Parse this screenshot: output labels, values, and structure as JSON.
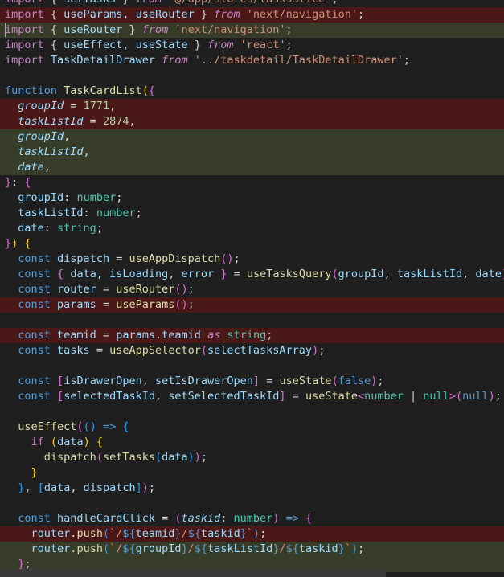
{
  "editor": {
    "lines": [
      [
        {
          "t": "import",
          "c": "k"
        },
        {
          "t": " { ",
          "c": "p"
        },
        {
          "t": "setTasks",
          "c": "v"
        },
        {
          "t": " } ",
          "c": "p"
        },
        {
          "t": "from",
          "c": "k i"
        },
        {
          "t": " ",
          "c": "p"
        },
        {
          "t": "'@/app/stores/tasksSlice'",
          "c": "s"
        },
        {
          "t": ";",
          "c": "p"
        }
      ],
      [
        {
          "t": "import",
          "c": "k"
        },
        {
          "t": " { ",
          "c": "p"
        },
        {
          "t": "useParams",
          "c": "v"
        },
        {
          "t": ", ",
          "c": "p"
        },
        {
          "t": "useRouter",
          "c": "v"
        },
        {
          "t": " } ",
          "c": "p"
        },
        {
          "t": "from",
          "c": "k i"
        },
        {
          "t": " ",
          "c": "p"
        },
        {
          "t": "'next/navigation'",
          "c": "s"
        },
        {
          "t": ";",
          "c": "p"
        }
      ],
      [
        {
          "t": "import",
          "c": "k"
        },
        {
          "t": " { ",
          "c": "p"
        },
        {
          "t": "useRouter",
          "c": "v"
        },
        {
          "t": " } ",
          "c": "p"
        },
        {
          "t": "from",
          "c": "k i"
        },
        {
          "t": " ",
          "c": "p"
        },
        {
          "t": "'next/navigation'",
          "c": "s"
        },
        {
          "t": ";",
          "c": "p"
        }
      ],
      [
        {
          "t": "import",
          "c": "k"
        },
        {
          "t": " { ",
          "c": "p"
        },
        {
          "t": "useEffect",
          "c": "v"
        },
        {
          "t": ", ",
          "c": "p"
        },
        {
          "t": "useState",
          "c": "v"
        },
        {
          "t": " } ",
          "c": "p"
        },
        {
          "t": "from",
          "c": "k i"
        },
        {
          "t": " ",
          "c": "p"
        },
        {
          "t": "'react'",
          "c": "s"
        },
        {
          "t": ";",
          "c": "p"
        }
      ],
      [
        {
          "t": "import",
          "c": "k"
        },
        {
          "t": " ",
          "c": "p"
        },
        {
          "t": "TaskDetailDrawer",
          "c": "v"
        },
        {
          "t": " ",
          "c": "p"
        },
        {
          "t": "from",
          "c": "k i"
        },
        {
          "t": " ",
          "c": "p"
        },
        {
          "t": "'../taskdetail/TaskDetailDrawer'",
          "c": "s"
        },
        {
          "t": ";",
          "c": "p"
        }
      ],
      [],
      [
        {
          "t": "function",
          "c": "kb"
        },
        {
          "t": " ",
          "c": "p"
        },
        {
          "t": "TaskCardList",
          "c": "f"
        },
        {
          "t": "(",
          "c": "pr"
        },
        {
          "t": "{",
          "c": "pv"
        }
      ],
      [
        {
          "t": "  ",
          "c": "p"
        },
        {
          "t": "groupId",
          "c": "v i"
        },
        {
          "t": " = ",
          "c": "p"
        },
        {
          "t": "1771",
          "c": "n"
        },
        {
          "t": ",",
          "c": "p"
        }
      ],
      [
        {
          "t": "  ",
          "c": "p"
        },
        {
          "t": "taskListId",
          "c": "v i"
        },
        {
          "t": " = ",
          "c": "p"
        },
        {
          "t": "2874",
          "c": "n"
        },
        {
          "t": ",",
          "c": "p"
        }
      ],
      [
        {
          "t": "  ",
          "c": "p"
        },
        {
          "t": "groupId",
          "c": "v i"
        },
        {
          "t": ",",
          "c": "p"
        }
      ],
      [
        {
          "t": "  ",
          "c": "p"
        },
        {
          "t": "taskListId",
          "c": "v i"
        },
        {
          "t": ",",
          "c": "p"
        }
      ],
      [
        {
          "t": "  ",
          "c": "p"
        },
        {
          "t": "date",
          "c": "v i"
        },
        {
          "t": ",",
          "c": "p"
        }
      ],
      [
        {
          "t": "}",
          "c": "pv"
        },
        {
          "t": ": ",
          "c": "p"
        },
        {
          "t": "{",
          "c": "pv"
        }
      ],
      [
        {
          "t": "  ",
          "c": "p"
        },
        {
          "t": "groupId",
          "c": "v"
        },
        {
          "t": ": ",
          "c": "p"
        },
        {
          "t": "number",
          "c": "t"
        },
        {
          "t": ";",
          "c": "p"
        }
      ],
      [
        {
          "t": "  ",
          "c": "p"
        },
        {
          "t": "taskListId",
          "c": "v"
        },
        {
          "t": ": ",
          "c": "p"
        },
        {
          "t": "number",
          "c": "t"
        },
        {
          "t": ";",
          "c": "p"
        }
      ],
      [
        {
          "t": "  ",
          "c": "p"
        },
        {
          "t": "date",
          "c": "v"
        },
        {
          "t": ": ",
          "c": "p"
        },
        {
          "t": "string",
          "c": "t"
        },
        {
          "t": ";",
          "c": "p"
        }
      ],
      [
        {
          "t": "}",
          "c": "pv"
        },
        {
          "t": ")",
          "c": "pr"
        },
        {
          "t": " ",
          "c": "p"
        },
        {
          "t": "{",
          "c": "pr"
        }
      ],
      [
        {
          "t": "  ",
          "c": "p"
        },
        {
          "t": "const",
          "c": "kb"
        },
        {
          "t": " ",
          "c": "p"
        },
        {
          "t": "dispatch",
          "c": "v"
        },
        {
          "t": " = ",
          "c": "p"
        },
        {
          "t": "useAppDispatch",
          "c": "f"
        },
        {
          "t": "()",
          "c": "pv"
        },
        {
          "t": ";",
          "c": "p"
        }
      ],
      [
        {
          "t": "  ",
          "c": "p"
        },
        {
          "t": "const",
          "c": "kb"
        },
        {
          "t": " ",
          "c": "p"
        },
        {
          "t": "{",
          "c": "pv"
        },
        {
          "t": " ",
          "c": "p"
        },
        {
          "t": "data",
          "c": "v"
        },
        {
          "t": ", ",
          "c": "p"
        },
        {
          "t": "isLoading",
          "c": "v"
        },
        {
          "t": ", ",
          "c": "p"
        },
        {
          "t": "error",
          "c": "v"
        },
        {
          "t": " ",
          "c": "p"
        },
        {
          "t": "}",
          "c": "pv"
        },
        {
          "t": " = ",
          "c": "p"
        },
        {
          "t": "useTasksQuery",
          "c": "f"
        },
        {
          "t": "(",
          "c": "pv"
        },
        {
          "t": "groupId",
          "c": "v"
        },
        {
          "t": ", ",
          "c": "p"
        },
        {
          "t": "taskListId",
          "c": "v"
        },
        {
          "t": ", ",
          "c": "p"
        },
        {
          "t": "date",
          "c": "v"
        },
        {
          "t": ")",
          "c": "pv"
        },
        {
          "t": ";",
          "c": "p"
        }
      ],
      [
        {
          "t": "  ",
          "c": "p"
        },
        {
          "t": "const",
          "c": "kb"
        },
        {
          "t": " ",
          "c": "p"
        },
        {
          "t": "router",
          "c": "v"
        },
        {
          "t": " = ",
          "c": "p"
        },
        {
          "t": "useRouter",
          "c": "f"
        },
        {
          "t": "()",
          "c": "pv"
        },
        {
          "t": ";",
          "c": "p"
        }
      ],
      [
        {
          "t": "  ",
          "c": "p"
        },
        {
          "t": "const",
          "c": "kb"
        },
        {
          "t": " ",
          "c": "p"
        },
        {
          "t": "params",
          "c": "v"
        },
        {
          "t": " = ",
          "c": "p"
        },
        {
          "t": "useParams",
          "c": "f"
        },
        {
          "t": "()",
          "c": "pv"
        },
        {
          "t": ";",
          "c": "p"
        }
      ],
      [],
      [
        {
          "t": "  ",
          "c": "p"
        },
        {
          "t": "const",
          "c": "kb"
        },
        {
          "t": " ",
          "c": "p"
        },
        {
          "t": "teamid",
          "c": "v"
        },
        {
          "t": " = ",
          "c": "p"
        },
        {
          "t": "params",
          "c": "v"
        },
        {
          "t": ".",
          "c": "p"
        },
        {
          "t": "teamid",
          "c": "v"
        },
        {
          "t": " ",
          "c": "p"
        },
        {
          "t": "as",
          "c": "k i"
        },
        {
          "t": " ",
          "c": "p"
        },
        {
          "t": "string",
          "c": "t"
        },
        {
          "t": ";",
          "c": "p"
        }
      ],
      [
        {
          "t": "  ",
          "c": "p"
        },
        {
          "t": "const",
          "c": "kb"
        },
        {
          "t": " ",
          "c": "p"
        },
        {
          "t": "tasks",
          "c": "v"
        },
        {
          "t": " = ",
          "c": "p"
        },
        {
          "t": "useAppSelector",
          "c": "f"
        },
        {
          "t": "(",
          "c": "pv"
        },
        {
          "t": "selectTasksArray",
          "c": "v"
        },
        {
          "t": ")",
          "c": "pv"
        },
        {
          "t": ";",
          "c": "p"
        }
      ],
      [],
      [
        {
          "t": "  ",
          "c": "p"
        },
        {
          "t": "const",
          "c": "kb"
        },
        {
          "t": " ",
          "c": "p"
        },
        {
          "t": "[",
          "c": "pv"
        },
        {
          "t": "isDrawerOpen",
          "c": "v"
        },
        {
          "t": ", ",
          "c": "p"
        },
        {
          "t": "setIsDrawerOpen",
          "c": "v"
        },
        {
          "t": "]",
          "c": "pv"
        },
        {
          "t": " = ",
          "c": "p"
        },
        {
          "t": "useState",
          "c": "f"
        },
        {
          "t": "(",
          "c": "pv"
        },
        {
          "t": "false",
          "c": "kb"
        },
        {
          "t": ")",
          "c": "pv"
        },
        {
          "t": ";",
          "c": "p"
        }
      ],
      [
        {
          "t": "  ",
          "c": "p"
        },
        {
          "t": "const",
          "c": "kb"
        },
        {
          "t": " ",
          "c": "p"
        },
        {
          "t": "[",
          "c": "pv"
        },
        {
          "t": "selectedTaskId",
          "c": "v"
        },
        {
          "t": ", ",
          "c": "p"
        },
        {
          "t": "setSelectedTaskId",
          "c": "v"
        },
        {
          "t": "]",
          "c": "pv"
        },
        {
          "t": " = ",
          "c": "p"
        },
        {
          "t": "useState",
          "c": "f"
        },
        {
          "t": "<",
          "c": "pv"
        },
        {
          "t": "number",
          "c": "t"
        },
        {
          "t": " | ",
          "c": "p"
        },
        {
          "t": "null",
          "c": "t"
        },
        {
          "t": ">",
          "c": "pv"
        },
        {
          "t": "(",
          "c": "pv"
        },
        {
          "t": "null",
          "c": "kb"
        },
        {
          "t": ")",
          "c": "pv"
        },
        {
          "t": ";",
          "c": "p"
        }
      ],
      [],
      [
        {
          "t": "  ",
          "c": "p"
        },
        {
          "t": "useEffect",
          "c": "f"
        },
        {
          "t": "(",
          "c": "pv"
        },
        {
          "t": "()",
          "c": "pb"
        },
        {
          "t": " ",
          "c": "p"
        },
        {
          "t": "=>",
          "c": "kb"
        },
        {
          "t": " ",
          "c": "p"
        },
        {
          "t": "{",
          "c": "pb"
        }
      ],
      [
        {
          "t": "    ",
          "c": "p"
        },
        {
          "t": "if",
          "c": "k"
        },
        {
          "t": " ",
          "c": "p"
        },
        {
          "t": "(",
          "c": "pr"
        },
        {
          "t": "data",
          "c": "v"
        },
        {
          "t": ")",
          "c": "pr"
        },
        {
          "t": " ",
          "c": "p"
        },
        {
          "t": "{",
          "c": "pr"
        }
      ],
      [
        {
          "t": "      ",
          "c": "p"
        },
        {
          "t": "dispatch",
          "c": "f"
        },
        {
          "t": "(",
          "c": "pv"
        },
        {
          "t": "setTasks",
          "c": "f"
        },
        {
          "t": "(",
          "c": "pb"
        },
        {
          "t": "data",
          "c": "v"
        },
        {
          "t": ")",
          "c": "pb"
        },
        {
          "t": ")",
          "c": "pv"
        },
        {
          "t": ";",
          "c": "p"
        }
      ],
      [
        {
          "t": "    ",
          "c": "p"
        },
        {
          "t": "}",
          "c": "pr"
        }
      ],
      [
        {
          "t": "  ",
          "c": "p"
        },
        {
          "t": "}",
          "c": "pb"
        },
        {
          "t": ", ",
          "c": "p"
        },
        {
          "t": "[",
          "c": "pb"
        },
        {
          "t": "data",
          "c": "v"
        },
        {
          "t": ", ",
          "c": "p"
        },
        {
          "t": "dispatch",
          "c": "v"
        },
        {
          "t": "]",
          "c": "pb"
        },
        {
          "t": ")",
          "c": "pv"
        },
        {
          "t": ";",
          "c": "p"
        }
      ],
      [],
      [
        {
          "t": "  ",
          "c": "p"
        },
        {
          "t": "const",
          "c": "kb"
        },
        {
          "t": " ",
          "c": "p"
        },
        {
          "t": "handleCardClick",
          "c": "v"
        },
        {
          "t": " = ",
          "c": "p"
        },
        {
          "t": "(",
          "c": "pv"
        },
        {
          "t": "taskid",
          "c": "v i"
        },
        {
          "t": ": ",
          "c": "p"
        },
        {
          "t": "number",
          "c": "t"
        },
        {
          "t": ")",
          "c": "pv"
        },
        {
          "t": " ",
          "c": "p"
        },
        {
          "t": "=>",
          "c": "kb"
        },
        {
          "t": " ",
          "c": "p"
        },
        {
          "t": "{",
          "c": "pv"
        }
      ],
      [
        {
          "t": "    ",
          "c": "p"
        },
        {
          "t": "router",
          "c": "v"
        },
        {
          "t": ".",
          "c": "p"
        },
        {
          "t": "push",
          "c": "f"
        },
        {
          "t": "(",
          "c": "pb"
        },
        {
          "t": "`/",
          "c": "s"
        },
        {
          "t": "${",
          "c": "kb"
        },
        {
          "t": "teamid",
          "c": "v"
        },
        {
          "t": "}",
          "c": "kb"
        },
        {
          "t": "/",
          "c": "s"
        },
        {
          "t": "${",
          "c": "kb"
        },
        {
          "t": "taskid",
          "c": "v"
        },
        {
          "t": "}",
          "c": "kb"
        },
        {
          "t": "`",
          "c": "s"
        },
        {
          "t": ")",
          "c": "pb"
        },
        {
          "t": ";",
          "c": "p"
        }
      ],
      [
        {
          "t": "    ",
          "c": "p"
        },
        {
          "t": "router",
          "c": "v"
        },
        {
          "t": ".",
          "c": "p"
        },
        {
          "t": "push",
          "c": "f"
        },
        {
          "t": "(",
          "c": "pb"
        },
        {
          "t": "`/",
          "c": "s"
        },
        {
          "t": "${",
          "c": "kb"
        },
        {
          "t": "groupId",
          "c": "v"
        },
        {
          "t": "}",
          "c": "kb"
        },
        {
          "t": "/",
          "c": "s"
        },
        {
          "t": "${",
          "c": "kb"
        },
        {
          "t": "taskListId",
          "c": "v"
        },
        {
          "t": "}",
          "c": "kb"
        },
        {
          "t": "/",
          "c": "s"
        },
        {
          "t": "${",
          "c": "kb"
        },
        {
          "t": "taskid",
          "c": "v"
        },
        {
          "t": "}",
          "c": "kb"
        },
        {
          "t": "`",
          "c": "s"
        },
        {
          "t": ")",
          "c": "pb"
        },
        {
          "t": ";",
          "c": "p"
        }
      ],
      [
        {
          "t": "  ",
          "c": "p"
        },
        {
          "t": "}",
          "c": "pv"
        },
        {
          "t": ";",
          "c": "p"
        }
      ]
    ],
    "diff": [
      "",
      "del",
      "add",
      "",
      "",
      "",
      "",
      "del",
      "del",
      "add",
      "add",
      "add",
      "",
      "",
      "",
      "",
      "",
      "",
      "",
      "",
      "del",
      "",
      "del",
      "",
      "",
      "",
      "",
      "",
      "",
      "",
      "",
      "",
      "",
      "",
      "",
      "del",
      "add",
      "add"
    ],
    "colors": {
      "background": "#1f1f1f",
      "deleted_line": "#4b1818",
      "added_line": "#373d29",
      "keyword": "#c586c0",
      "storage": "#569cd6",
      "function": "#dcdcaa",
      "string": "#ce9178",
      "number": "#b5cea8",
      "variable": "#9cdcfe",
      "type": "#4ec9b0"
    }
  }
}
